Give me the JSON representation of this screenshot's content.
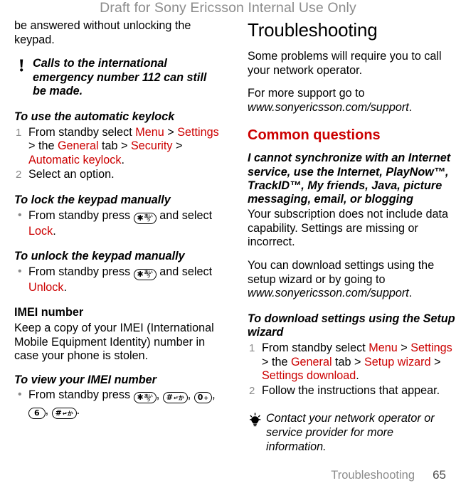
{
  "header": {
    "watermark": "Draft for Sony Ericsson Internal Use Only",
    "watermark_color": "#8c8c8c"
  },
  "colors": {
    "accent_red": "#cc0000",
    "marker_gray": "#8a8a8a",
    "footer_gray": "#8c8c8c"
  },
  "left_column": {
    "continued_paragraph": "be answered without unlocking the keypad.",
    "note_callout": {
      "icon": "exclamation-icon",
      "text": "Calls to the international emergency number 112 can still be made."
    },
    "proc_auto_keylock": {
      "heading": "To use the automatic keylock",
      "steps": [
        {
          "marker": "1",
          "parts": [
            {
              "text": "From standby select ",
              "style": "plain"
            },
            {
              "text": "Menu",
              "style": "red"
            },
            {
              "text": " > ",
              "style": "plain"
            },
            {
              "text": "Settings",
              "style": "red"
            },
            {
              "text": " > the ",
              "style": "plain"
            },
            {
              "text": "General",
              "style": "red"
            },
            {
              "text": " tab > ",
              "style": "plain"
            },
            {
              "text": "Security",
              "style": "red"
            },
            {
              "text": " > ",
              "style": "plain"
            },
            {
              "text": "Automatic keylock",
              "style": "red"
            },
            {
              "text": ".",
              "style": "plain"
            }
          ]
        },
        {
          "marker": "2",
          "parts": [
            {
              "text": "Select an option.",
              "style": "plain"
            }
          ]
        }
      ]
    },
    "proc_lock_manually": {
      "heading": "To lock the keypad manually",
      "marker": "•",
      "parts": [
        {
          "text": "From standby press ",
          "style": "plain"
        },
        {
          "text": "KEY:star",
          "style": "key"
        },
        {
          "text": " and select ",
          "style": "plain"
        },
        {
          "text": "Lock",
          "style": "red"
        },
        {
          "text": ".",
          "style": "plain"
        }
      ]
    },
    "proc_unlock_manually": {
      "heading": "To unlock the keypad manually",
      "marker": "•",
      "parts": [
        {
          "text": "From standby press ",
          "style": "plain"
        },
        {
          "text": "KEY:star",
          "style": "key"
        },
        {
          "text": " and select ",
          "style": "plain"
        },
        {
          "text": "Unlock",
          "style": "red"
        },
        {
          "text": ".",
          "style": "plain"
        }
      ]
    },
    "imei": {
      "heading": "IMEI number",
      "paragraph": "Keep a copy of your IMEI (International Mobile Equipment Identity) number in case your phone is stolen.",
      "proc_heading": "To view your IMEI number",
      "marker": "•",
      "lead": "From standby press ",
      "key_sequence": [
        "star",
        "hash",
        "zero",
        "six",
        "hash"
      ],
      "trailing": "."
    }
  },
  "right_column": {
    "chapter_title": "Troubleshooting",
    "intro_1": "Some problems will require you to call your network operator.",
    "intro_2_lead": "For more support go to ",
    "intro_2_url": "www.sonyericsson.com/support",
    "intro_2_trail": ".",
    "section_title": "Common questions",
    "question_heading": "I cannot synchronize with an Internet service, use the Internet, PlayNow™, TrackID™, My friends, Java, picture messaging, email, or blogging",
    "answer_1": "Your subscription does not include data capability. Settings are missing or incorrect.",
    "answer_2_lead": "You can download settings using the setup wizard or by going to ",
    "answer_2_url": "www.sonyericsson.com/support",
    "answer_2_trail": ".",
    "proc_download": {
      "heading": "To download settings using the Setup wizard",
      "steps": [
        {
          "marker": "1",
          "parts": [
            {
              "text": "From standby select ",
              "style": "plain"
            },
            {
              "text": "Menu",
              "style": "red"
            },
            {
              "text": " > ",
              "style": "plain"
            },
            {
              "text": "Settings",
              "style": "red"
            },
            {
              "text": " > the ",
              "style": "plain"
            },
            {
              "text": "General",
              "style": "red"
            },
            {
              "text": " tab > ",
              "style": "plain"
            },
            {
              "text": "Setup wizard",
              "style": "red"
            },
            {
              "text": " > ",
              "style": "plain"
            },
            {
              "text": "Settings download",
              "style": "red"
            },
            {
              "text": ".",
              "style": "plain"
            }
          ]
        },
        {
          "marker": "2",
          "parts": [
            {
              "text": "Follow the instructions that appear.",
              "style": "plain"
            }
          ]
        }
      ]
    },
    "tip_callout": {
      "icon": "lightbulb-icon",
      "text": "Contact your network operator or service provider for more information."
    }
  },
  "keys": {
    "star": {
      "main": "✱",
      "sub_top": "あい",
      "sub_bottom": "う",
      "label": "star-key"
    },
    "hash": {
      "main": "#",
      "flat": "↵か",
      "label": "hash-key"
    },
    "zero": {
      "main": "0",
      "flat": "+",
      "label": "zero-plus-key"
    },
    "six": {
      "main": "6",
      "flat": "",
      "label": "six-key"
    }
  },
  "footer": {
    "title": "Troubleshooting",
    "page_number": "65"
  }
}
